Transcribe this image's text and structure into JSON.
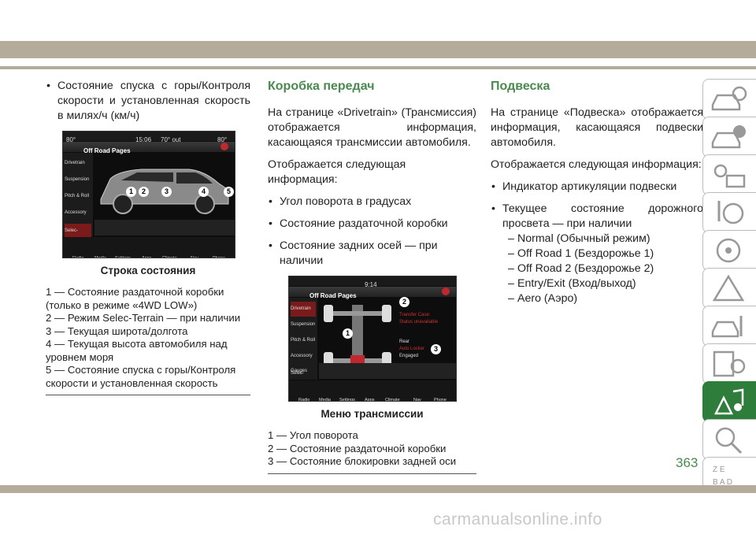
{
  "col1": {
    "bullet": "Состояние спуска с горы/Контроля скорости и установленная скорость в милях/ч (км/ч)",
    "figure": {
      "screen": {
        "top_left_temp": "80°",
        "top_right_temp": "80°",
        "center_time": "15:06",
        "center_temp": "70° out",
        "title": "Off Road Pages",
        "menu": [
          "Drivetrain",
          "Suspension",
          "Pitch & Roll",
          "Accessory Gauges",
          "Selec-Terrain"
        ],
        "bottom_icons": [
          "Radio",
          "Media",
          "Settings",
          "Apps",
          "Climate",
          "Nav",
          "Phone"
        ],
        "callouts": [
          "1",
          "2",
          "3",
          "4",
          "5"
        ]
      },
      "caption": "Строка состояния"
    },
    "legend": [
      "1 — Состояние раздаточной коробки (только в режиме «4WD LOW»)",
      "2 — Режим Selec-Terrain — при наличии",
      "3 — Текущая широта/долгота",
      "4 — Текущая высота автомобиля над уровнем моря",
      "5 — Состояние спуска с горы/Контроля скорости и установленная скорость"
    ]
  },
  "col2": {
    "heading": "Коробка передач",
    "p1": "На странице «Drivetrain» (Трансмиссия) отображается информация, касающаяся трансмиссии автомобиля.",
    "p2": "Отображается следующая информация:",
    "bullets": [
      "Угол поворота в градусах",
      "Состояние раздаточной коробки",
      "Состояние задних осей — при наличии"
    ],
    "figure": {
      "screen": {
        "time": "9:14",
        "title": "Off Road Pages",
        "menu": [
          "Drivetrain",
          "Suspension",
          "Pitch & Roll",
          "Accessory Gauges",
          "Selec-Terrain"
        ],
        "transfer_case": "Transfer Case:",
        "transfer_status": "Status unavailable",
        "rear": "Rear",
        "rear_mode": "Auto Locker",
        "rear_status": "Engaged",
        "bottom_icons": [
          "Radio",
          "Media",
          "Settings",
          "Apps",
          "Climate",
          "Nav",
          "Phone"
        ],
        "callouts": [
          "1",
          "2",
          "3"
        ]
      },
      "caption": "Меню трансмиссии"
    },
    "legend": [
      "1 — Угол поворота",
      "2 — Состояние раздаточной коробки",
      "3 — Состояние блокировки задней оси"
    ]
  },
  "col3": {
    "heading": "Подвеска",
    "p1": "На странице «Подвеска» отображается информация, касающаяся подвески автомобиля.",
    "p2": "Отображается следующая информация:",
    "bullet1": "Индикатор артикуляции подвески",
    "bullet2": "Текущее состояние дорожного просвета — при наличии",
    "dashes": [
      "Normal (Обычный режим)",
      "Off Road 1 (Бездорожье 1)",
      "Off Road 2 (Бездорожье 2)",
      "Entry/Exit (Вход/выход)",
      "Aero (Аэро)"
    ]
  },
  "page_number": "363",
  "watermark": "carmanualsonline.info",
  "tabs": [
    "car-info-icon",
    "car-warning-icon",
    "dashboard-lights-icon",
    "starting-icon",
    "driving-icon",
    "safety-icon",
    "maintenance-icon",
    "specs-icon",
    "multimedia-icon",
    "search-icon",
    "index-icon"
  ]
}
